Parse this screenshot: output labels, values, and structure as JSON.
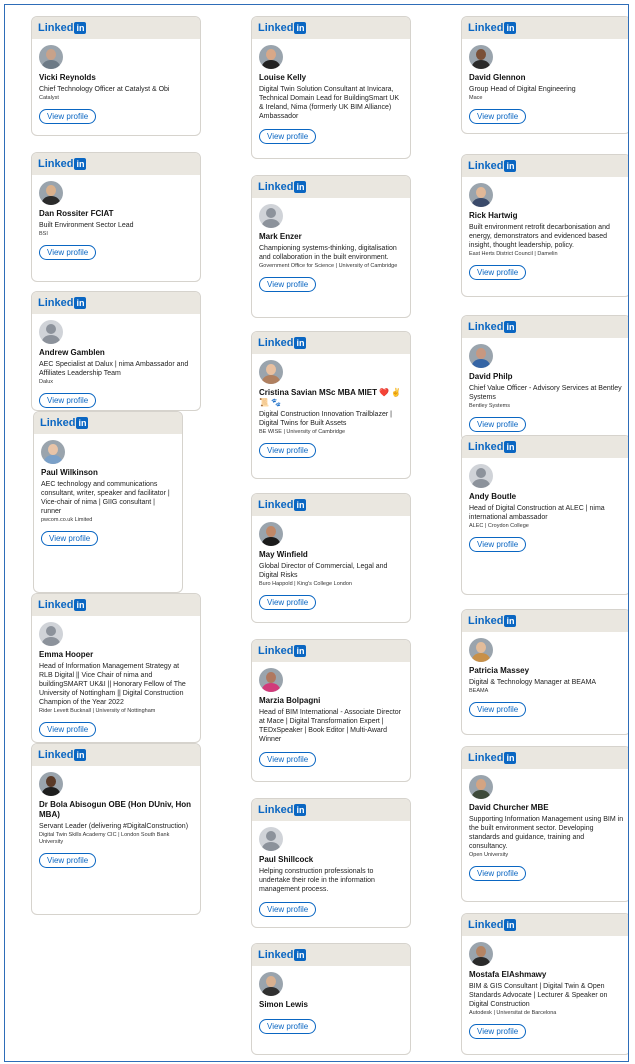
{
  "brand": {
    "wordmark": "Linked",
    "badge": "in",
    "color": "#0a66c2"
  },
  "button_label": "View profile",
  "profiles": [
    {
      "name": "Vicki Reynolds",
      "headline": "Chief Technology Officer at Catalyst & Obi",
      "org": "Catalyst",
      "avatar": "photo"
    },
    {
      "name": "Dan Rossiter FCIAT",
      "headline": "Built Environment Sector Lead",
      "org": "BSI",
      "avatar": "photo"
    },
    {
      "name": "Andrew Gamblen",
      "headline": "AEC Specialist at Dalux | nima Ambassador and Affiliates Leadership Team",
      "org": "Dalux",
      "avatar": "default"
    },
    {
      "name": "Paul Wilkinson",
      "headline": "AEC technology and communications consultant, writer, speaker and facilitator | Vice-chair of nima | GIIG consultant | runner",
      "org": "pwcom.co.uk Limited",
      "avatar": "photo"
    },
    {
      "name": "Emma Hooper",
      "headline": "Head of Information Management Strategy at RLB Digital || Vice Chair of nima and buildingSMART UK&I || Honorary Fellow of The University of Nottingham || Digital Construction Champion of the Year 2022",
      "org": "Rider Levett Bucknall | University of Nottingham",
      "avatar": "default"
    },
    {
      "name": "Dr Bola Abisogun OBE (Hon DUniv, Hon MBA)",
      "headline": "Servant Leader (delivering #DigitalConstruction)",
      "org": "Digital Twin Skills Academy CIC | London South Bank University",
      "avatar": "photo"
    },
    {
      "name": "Louise Kelly",
      "headline": "Digital Twin Solution Consultant at Invicara, Technical Domain Lead for BuildingSmart UK & Ireland, Nima (formerly UK BIM Alliance) Ambassador",
      "org": "",
      "avatar": "photo"
    },
    {
      "name": "Mark Enzer",
      "headline": "Championing systems-thinking, digitalisation and collaboration in the built environment.",
      "org": "Government Office for Science | University of Cambridge",
      "avatar": "default"
    },
    {
      "name": "Cristina Savian MSc MBA MIET ❤️ ✌️ 📜 🐾",
      "headline": "Digital Construction Innovation Trailblazer | Digital Twins for Built Assets",
      "org": "BE WISE | University of Cambridge",
      "avatar": "photo"
    },
    {
      "name": "May Winfield",
      "headline": "Global Director of Commercial, Legal and Digital Risks",
      "org": "Buro Happold | King's College London",
      "avatar": "photo"
    },
    {
      "name": "Marzia Bolpagni",
      "headline": "Head of BIM International - Associate Director at Mace | Digital Transformation Expert | TEDxSpeaker | Book Editor | Multi-Award Winner",
      "org": "",
      "avatar": "photo"
    },
    {
      "name": "Paul Shillcock",
      "headline": "Helping construction professionals to undertake their role in the information management process.",
      "org": "",
      "avatar": "default"
    },
    {
      "name": "Simon Lewis",
      "headline": "",
      "org": "",
      "avatar": "photo"
    },
    {
      "name": "David Glennon",
      "headline": "Group Head of Digital Engineering",
      "org": "Mace",
      "avatar": "photo"
    },
    {
      "name": "Rick Hartwig",
      "headline": "Built environment retrofit decarbonisation and energy, demonstrators and evidenced based insight, thought leadership, policy.",
      "org": "East Herts District Council | Damelin",
      "avatar": "photo"
    },
    {
      "name": "David Philp",
      "headline": "Chief Value Officer - Advisory Services at Bentley Systems",
      "org": "Bentley Systems",
      "avatar": "photo"
    },
    {
      "name": "Andy Boutle",
      "headline": "Head of Digital Construction at ALEC | nima international ambassador",
      "org": "ALEC | Croydon College",
      "avatar": "default"
    },
    {
      "name": "Patricia Massey",
      "headline": "Digital & Technology Manager at BEAMA",
      "org": "BEAMA",
      "avatar": "photo"
    },
    {
      "name": "David Churcher MBE",
      "headline": "Supporting Information Management using BIM in the built environment sector. Developing standards and guidance, training and consultancy.",
      "org": "Open University",
      "avatar": "photo"
    },
    {
      "name": "Mostafa ElAshmawy",
      "headline": "BIM & GIS Consultant | Digital Twin & Open Standards Advocate | Lecturer & Speaker on Digital Construction",
      "org": "Autodesk | Universitat de Barcelona",
      "avatar": "photo"
    }
  ]
}
